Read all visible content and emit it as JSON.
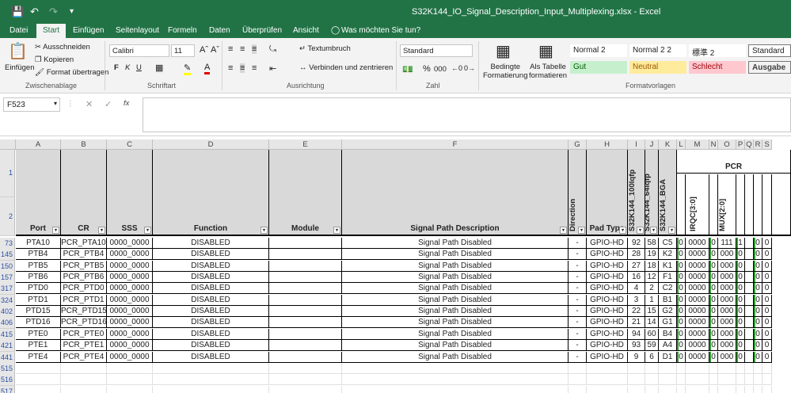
{
  "window": {
    "title": "S32K144_IO_Signal_Description_Input_Multiplexing.xlsx - Excel"
  },
  "tabs": [
    "Datei",
    "Start",
    "Einfügen",
    "Seitenlayout",
    "Formeln",
    "Daten",
    "Überprüfen",
    "Ansicht"
  ],
  "tellme": "Was möchten Sie tun?",
  "ribbon": {
    "clipboard": {
      "paste": "Einfügen",
      "cut": "Ausschneiden",
      "copy": "Kopieren",
      "painter": "Format übertragen",
      "label": "Zwischenablage"
    },
    "font": {
      "name": "Calibri",
      "size": "11",
      "bold": "F",
      "italic": "K",
      "underline": "U",
      "label": "Schriftart"
    },
    "alignment": {
      "wrap": "Textumbruch",
      "merge": "Verbinden und zentrieren",
      "label": "Ausrichtung"
    },
    "number": {
      "format": "Standard",
      "percent": "%",
      "thousands": "000",
      "label": "Zahl"
    },
    "cond": {
      "cond_label": "Bedingte\nFormatierung",
      "table_label": "Als Tabelle\nformatieren"
    },
    "styles": {
      "items": [
        {
          "name": "Normal 2",
          "bg": "#ffffff",
          "fg": "#222222"
        },
        {
          "name": "Normal 2 2",
          "bg": "#ffffff",
          "fg": "#222222"
        },
        {
          "name": "標準 2",
          "bg": "#ffffff",
          "fg": "#222222"
        },
        {
          "name": "Standard",
          "bg": "#ffffff",
          "fg": "#222222"
        },
        {
          "name": "Gut",
          "bg": "#c6efce",
          "fg": "#006100"
        },
        {
          "name": "Neutral",
          "bg": "#ffeb9c",
          "fg": "#9c5700"
        },
        {
          "name": "Schlecht",
          "bg": "#ffc7ce",
          "fg": "#9c0006"
        },
        {
          "name": "Ausgabe",
          "bg": "#f2f2f2",
          "fg": "#3f3f3f"
        }
      ],
      "label": "Formatvorlagen"
    }
  },
  "formula_bar": {
    "namebox": "F523",
    "fx": "fx",
    "content": ""
  },
  "columns": [
    "A",
    "B",
    "C",
    "D",
    "E",
    "F",
    "G",
    "H",
    "I",
    "J",
    "K",
    "L",
    "M",
    "N",
    "O",
    "P",
    "Q",
    "R",
    "S"
  ],
  "header_row": {
    "port": "Port",
    "cr": "CR",
    "sss": "SSS",
    "function": "Function",
    "module": "Module",
    "description": "Signal Path Description",
    "direction": "Direction",
    "padtype": "Pad Type",
    "pkg100": "S32K144_100lqfp",
    "pkg64": "S32K144_64lqfp",
    "bga": "S32K144_BGA",
    "pcr": "PCR",
    "irqc": "IRQC[3:0]",
    "mux": "MUX[2:0]"
  },
  "row_numbers": [
    "73",
    "145",
    "150",
    "157",
    "317",
    "324",
    "402",
    "406",
    "415",
    "421",
    "441",
    "515",
    "516",
    "517"
  ],
  "rows": [
    {
      "port": "PTA10",
      "cr": "PCR_PTA10",
      "sss": "0000_0000",
      "function": "DISABLED",
      "desc": "Signal Path Disabled",
      "dir": "-",
      "pad": "GPIO-HD",
      "p100": "92",
      "p64": "58",
      "bga": "C5",
      "l": "0",
      "irqc": "0000",
      "n": "0",
      "mux": "111",
      "p": "1",
      "r": "0",
      "s": "0"
    },
    {
      "port": "PTB4",
      "cr": "PCR_PTB4",
      "sss": "0000_0000",
      "function": "DISABLED",
      "desc": "Signal Path Disabled",
      "dir": "-",
      "pad": "GPIO-HD",
      "p100": "28",
      "p64": "19",
      "bga": "K2",
      "l": "0",
      "irqc": "0000",
      "n": "0",
      "mux": "000",
      "p": "0",
      "r": "0",
      "s": "0"
    },
    {
      "port": "PTB5",
      "cr": "PCR_PTB5",
      "sss": "0000_0000",
      "function": "DISABLED",
      "desc": "Signal Path Disabled",
      "dir": "-",
      "pad": "GPIO-HD",
      "p100": "27",
      "p64": "18",
      "bga": "K1",
      "l": "0",
      "irqc": "0000",
      "n": "0",
      "mux": "000",
      "p": "0",
      "r": "0",
      "s": "0"
    },
    {
      "port": "PTB6",
      "cr": "PCR_PTB6",
      "sss": "0000_0000",
      "function": "DISABLED",
      "desc": "Signal Path Disabled",
      "dir": "-",
      "pad": "GPIO-HD",
      "p100": "16",
      "p64": "12",
      "bga": "F1",
      "l": "0",
      "irqc": "0000",
      "n": "0",
      "mux": "000",
      "p": "0",
      "r": "0",
      "s": "0"
    },
    {
      "port": "PTD0",
      "cr": "PCR_PTD0",
      "sss": "0000_0000",
      "function": "DISABLED",
      "desc": "Signal Path Disabled",
      "dir": "-",
      "pad": "GPIO-HD",
      "p100": "4",
      "p64": "2",
      "bga": "C2",
      "l": "0",
      "irqc": "0000",
      "n": "0",
      "mux": "000",
      "p": "0",
      "r": "0",
      "s": "0"
    },
    {
      "port": "PTD1",
      "cr": "PCR_PTD1",
      "sss": "0000_0000",
      "function": "DISABLED",
      "desc": "Signal Path Disabled",
      "dir": "-",
      "pad": "GPIO-HD",
      "p100": "3",
      "p64": "1",
      "bga": "B1",
      "l": "0",
      "irqc": "0000",
      "n": "0",
      "mux": "000",
      "p": "0",
      "r": "0",
      "s": "0"
    },
    {
      "port": "PTD15",
      "cr": "PCR_PTD15",
      "sss": "0000_0000",
      "function": "DISABLED",
      "desc": "Signal Path Disabled",
      "dir": "-",
      "pad": "GPIO-HD",
      "p100": "22",
      "p64": "15",
      "bga": "G2",
      "l": "0",
      "irqc": "0000",
      "n": "0",
      "mux": "000",
      "p": "0",
      "r": "0",
      "s": "0"
    },
    {
      "port": "PTD16",
      "cr": "PCR_PTD16",
      "sss": "0000_0000",
      "function": "DISABLED",
      "desc": "Signal Path Disabled",
      "dir": "-",
      "pad": "GPIO-HD",
      "p100": "21",
      "p64": "14",
      "bga": "G1",
      "l": "0",
      "irqc": "0000",
      "n": "0",
      "mux": "000",
      "p": "0",
      "r": "0",
      "s": "0"
    },
    {
      "port": "PTE0",
      "cr": "PCR_PTE0",
      "sss": "0000_0000",
      "function": "DISABLED",
      "desc": "Signal Path Disabled",
      "dir": "-",
      "pad": "GPIO-HD",
      "p100": "94",
      "p64": "60",
      "bga": "B4",
      "l": "0",
      "irqc": "0000",
      "n": "0",
      "mux": "000",
      "p": "0",
      "r": "0",
      "s": "0"
    },
    {
      "port": "PTE1",
      "cr": "PCR_PTE1",
      "sss": "0000_0000",
      "function": "DISABLED",
      "desc": "Signal Path Disabled",
      "dir": "-",
      "pad": "GPIO-HD",
      "p100": "93",
      "p64": "59",
      "bga": "A4",
      "l": "0",
      "irqc": "0000",
      "n": "0",
      "mux": "000",
      "p": "0",
      "r": "0",
      "s": "0"
    },
    {
      "port": "PTE4",
      "cr": "PCR_PTE4",
      "sss": "0000_0000",
      "function": "DISABLED",
      "desc": "Signal Path Disabled",
      "dir": "-",
      "pad": "GPIO-HD",
      "p100": "9",
      "p64": "6",
      "bga": "D1",
      "l": "0",
      "irqc": "0000",
      "n": "0",
      "mux": "000",
      "p": "0",
      "r": "0",
      "s": "0"
    }
  ]
}
